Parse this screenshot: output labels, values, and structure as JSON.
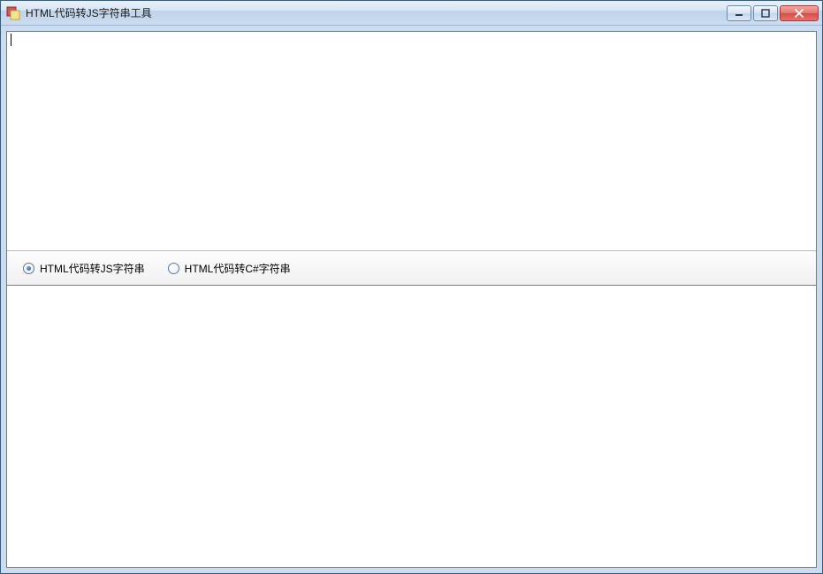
{
  "window": {
    "title": "HTML代码转JS字符串工具"
  },
  "controls": {
    "minimize_name": "minimize",
    "maximize_name": "maximize",
    "close_name": "close"
  },
  "radios": {
    "option_js": "HTML代码转JS字符串",
    "option_cs": "HTML代码转C#字符串",
    "selected": "js"
  },
  "input": {
    "value": ""
  },
  "output": {
    "value": ""
  }
}
